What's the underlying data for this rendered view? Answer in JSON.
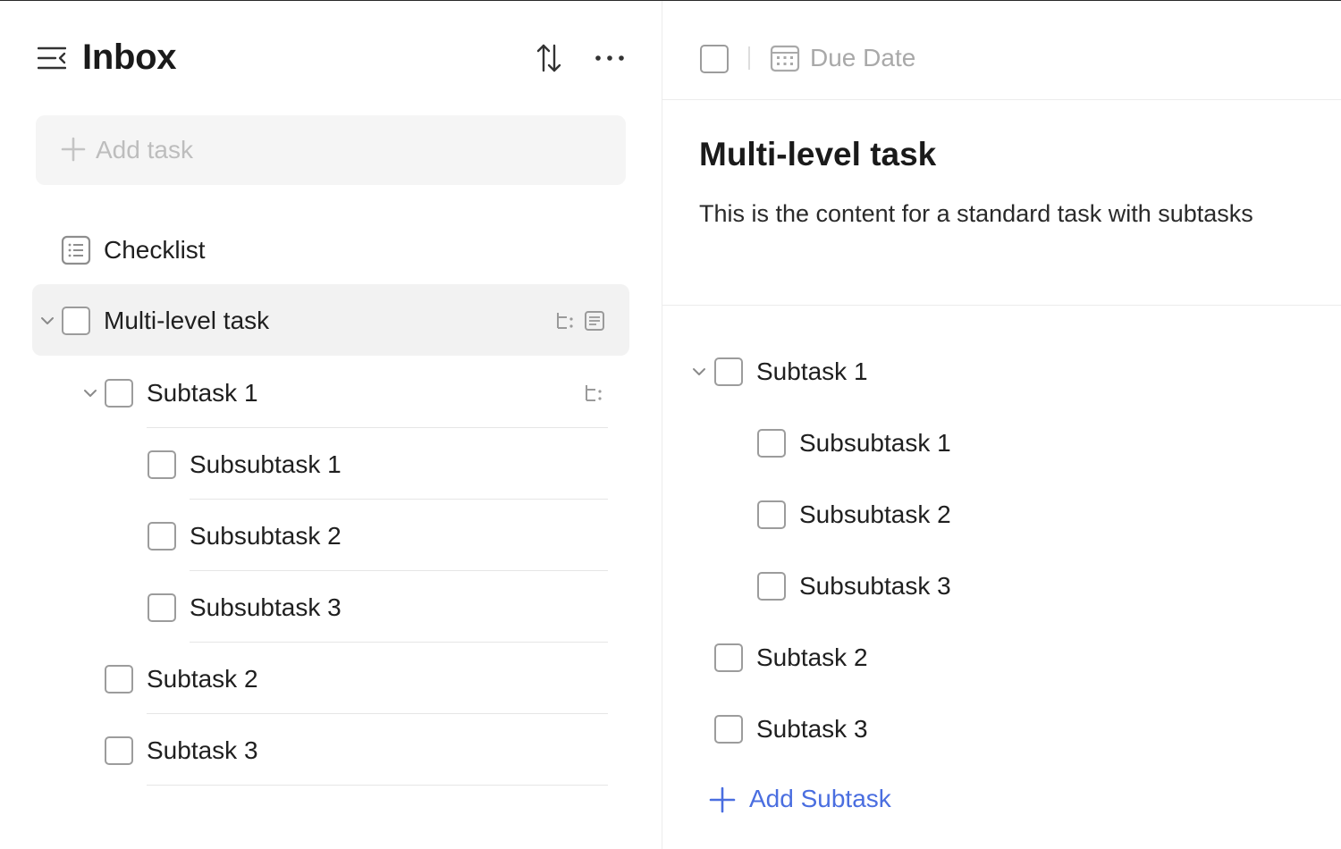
{
  "left": {
    "title": "Inbox",
    "add_task_placeholder": "Add task",
    "items": [
      {
        "label": "Checklist",
        "type": "note"
      },
      {
        "label": "Multi-level task",
        "type": "task",
        "selected": true,
        "expanded": true
      },
      {
        "label": "Subtask 1",
        "type": "task",
        "expanded": true
      },
      {
        "label": "Subsubtask 1",
        "type": "task"
      },
      {
        "label": "Subsubtask 2",
        "type": "task"
      },
      {
        "label": "Subsubtask 3",
        "type": "task"
      },
      {
        "label": "Subtask 2",
        "type": "task"
      },
      {
        "label": "Subtask 3",
        "type": "task"
      }
    ]
  },
  "detail": {
    "due_date_label": "Due Date",
    "title": "Multi-level task",
    "content": "This is the content for a standard task with subtasks",
    "subtasks": [
      {
        "label": "Subtask 1",
        "expanded": true
      },
      {
        "label": "Subsubtask 1"
      },
      {
        "label": "Subsubtask 2"
      },
      {
        "label": "Subsubtask 3"
      },
      {
        "label": "Subtask 2"
      },
      {
        "label": "Subtask 3"
      }
    ],
    "add_subtask_label": "Add Subtask"
  },
  "colors": {
    "accent": "#4a6ee0",
    "selected_row_bg": "#f2f2f2",
    "add_box_bg": "#f5f5f5",
    "placeholder": "#bdbdbd",
    "checkbox_border": "#9c9c9c"
  },
  "icons": {
    "menu": "collapse-menu-icon",
    "sort": "sort-icon",
    "more": "more-horizontal-icon",
    "plus": "plus-icon",
    "note": "note-list-icon",
    "subtask": "subtask-tree-icon",
    "calendar": "calendar-icon",
    "chevron": "chevron-down-icon"
  }
}
